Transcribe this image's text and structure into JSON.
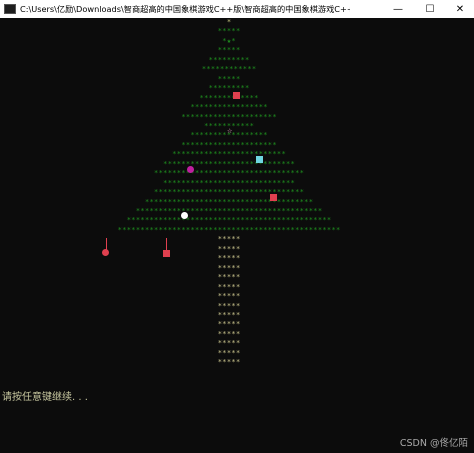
{
  "window": {
    "title": "C:\\Users\\亿励\\Downloads\\智商超高的中国象棋游戏C++版\\智商超高的中国象棋游戏C++版\\最丑圣诞树代码.exe",
    "minimize_glyph": "—",
    "maximize_glyph": "☐",
    "close_glyph": "✕"
  },
  "tree": {
    "top_star": "*",
    "foliage_rows": [
      "*****",
      "*★*",
      "*****",
      "*********",
      "************",
      "*****",
      "*********",
      "*************",
      "*****************",
      "*********************",
      "***********",
      "*****************",
      "*********************",
      "*************************",
      "*****************************",
      "*********************************",
      "*****************************",
      "*********************************",
      "*************************************",
      "*****************************************",
      "*********************************************",
      "*************************************************"
    ],
    "trunk_row": "*****",
    "trunk_count": 14,
    "ornament_colors": {
      "red": "#e0404f",
      "cyan": "#6fd6e0",
      "magenta": "#c020a0",
      "white": "#ffffff",
      "pink_star": "#e0a0c0"
    }
  },
  "console": {
    "prompt": "请按任意键继续. . ."
  },
  "watermark": "CSDN @佟亿陌"
}
